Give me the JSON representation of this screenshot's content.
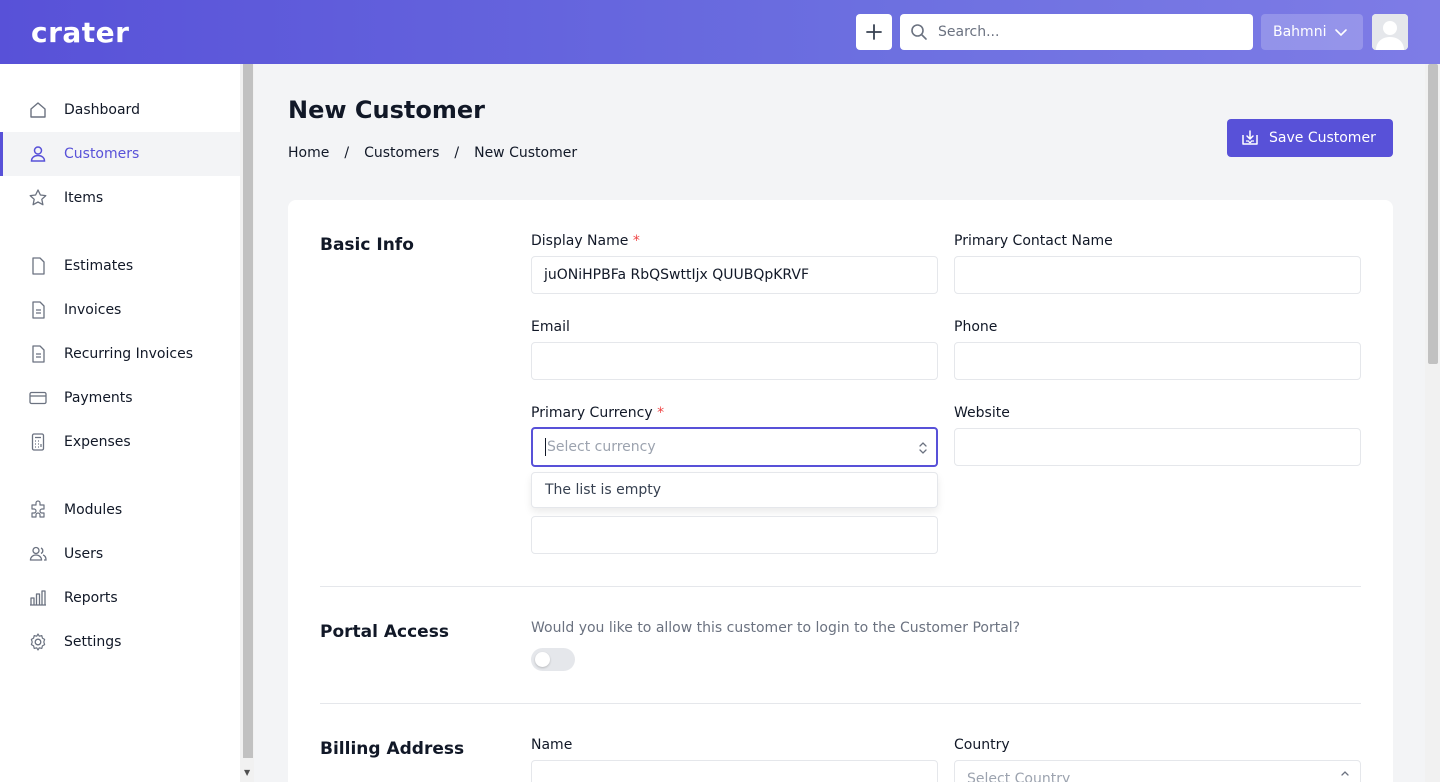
{
  "app": {
    "logo": "crater"
  },
  "header": {
    "search_placeholder": "Search...",
    "company": "Bahmni"
  },
  "sidebar": {
    "items": [
      {
        "label": "Dashboard",
        "icon": "home-icon"
      },
      {
        "label": "Customers",
        "icon": "user-icon",
        "active": true
      },
      {
        "label": "Items",
        "icon": "star-icon"
      },
      {
        "label": "Estimates",
        "icon": "document-icon"
      },
      {
        "label": "Invoices",
        "icon": "document-text-icon"
      },
      {
        "label": "Recurring Invoices",
        "icon": "document-text-icon"
      },
      {
        "label": "Payments",
        "icon": "credit-card-icon"
      },
      {
        "label": "Expenses",
        "icon": "calculator-icon"
      },
      {
        "label": "Modules",
        "icon": "puzzle-icon"
      },
      {
        "label": "Users",
        "icon": "users-icon"
      },
      {
        "label": "Reports",
        "icon": "chart-bar-icon"
      },
      {
        "label": "Settings",
        "icon": "cog-icon"
      }
    ]
  },
  "page": {
    "title": "New Customer",
    "breadcrumb": [
      "Home",
      "Customers",
      "New Customer"
    ],
    "save_label": "Save Customer"
  },
  "form": {
    "basic_info_title": "Basic Info",
    "display_name_label": "Display Name",
    "display_name_value": "juONiHPBFa RbQSwttIjx QUUBQpKRVF",
    "primary_contact_label": "Primary Contact Name",
    "email_label": "Email",
    "phone_label": "Phone",
    "currency_label": "Primary Currency",
    "currency_placeholder": "Select currency",
    "currency_dropdown_empty": "The list is empty",
    "website_label": "Website",
    "required_mark": "*",
    "portal_title": "Portal Access",
    "portal_question": "Would you like to allow this customer to login to the Customer Portal?",
    "portal_enabled": false,
    "billing_title": "Billing Address",
    "billing_name_label": "Name",
    "billing_country_label": "Country",
    "billing_country_placeholder": "Select Country"
  },
  "colors": {
    "accent": "#5851d8",
    "required": "#ef4444"
  }
}
